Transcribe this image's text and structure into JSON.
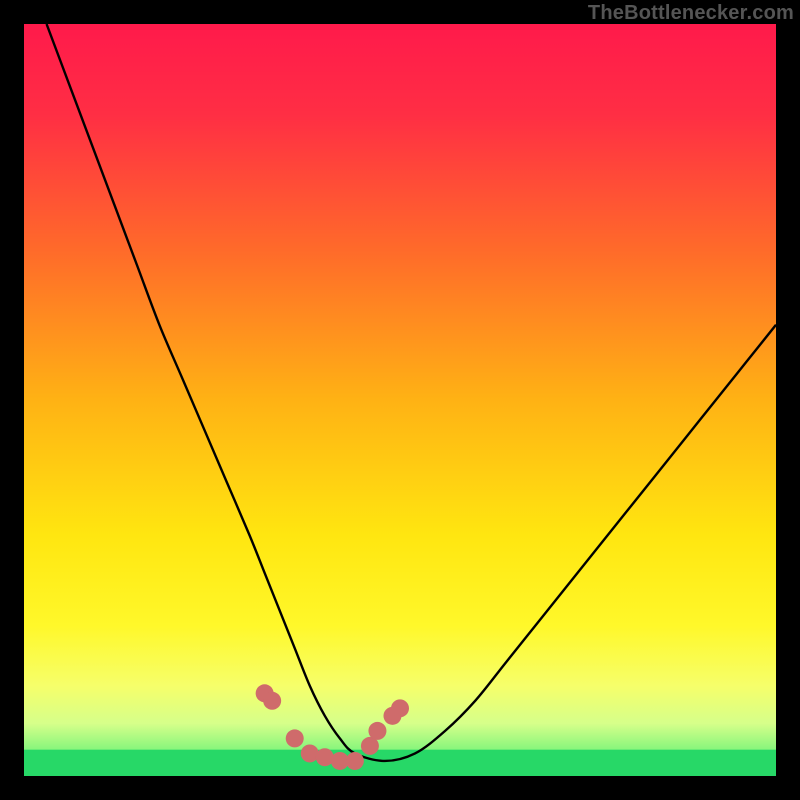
{
  "attribution": "TheBottlenecker.com",
  "colors": {
    "frame": "#000000",
    "curve": "#000000",
    "markers": "#cf6b6b",
    "baseline": "#27d867",
    "gradient_stops": [
      {
        "offset": 0.0,
        "color": "#ff1a4b"
      },
      {
        "offset": 0.12,
        "color": "#ff2e44"
      },
      {
        "offset": 0.3,
        "color": "#ff6a2a"
      },
      {
        "offset": 0.5,
        "color": "#ffb214"
      },
      {
        "offset": 0.68,
        "color": "#ffe610"
      },
      {
        "offset": 0.8,
        "color": "#fff82a"
      },
      {
        "offset": 0.88,
        "color": "#f6ff6a"
      },
      {
        "offset": 0.93,
        "color": "#d6ff8a"
      },
      {
        "offset": 0.97,
        "color": "#7cf47a"
      },
      {
        "offset": 1.0,
        "color": "#27d867"
      }
    ]
  },
  "chart_data": {
    "type": "line",
    "title": "",
    "xlabel": "",
    "ylabel": "",
    "xlim": [
      0,
      100
    ],
    "ylim": [
      0,
      100
    ],
    "x": [
      3,
      6,
      9,
      12,
      15,
      18,
      21,
      24,
      27,
      30,
      32,
      34,
      36,
      38,
      40,
      42,
      44,
      48,
      52,
      56,
      60,
      64,
      68,
      72,
      76,
      80,
      84,
      88,
      92,
      96,
      100
    ],
    "values": [
      100,
      92,
      84,
      76,
      68,
      60,
      53,
      46,
      39,
      32,
      27,
      22,
      17,
      12,
      8,
      5,
      3,
      2,
      3,
      6,
      10,
      15,
      20,
      25,
      30,
      35,
      40,
      45,
      50,
      55,
      60
    ],
    "markers": {
      "x": [
        32,
        33,
        36,
        38,
        40,
        42,
        44,
        46,
        47,
        49,
        50
      ],
      "y": [
        11,
        10,
        5,
        3,
        2.5,
        2,
        2,
        4,
        6,
        8,
        9
      ]
    },
    "baseline_y": 2
  }
}
